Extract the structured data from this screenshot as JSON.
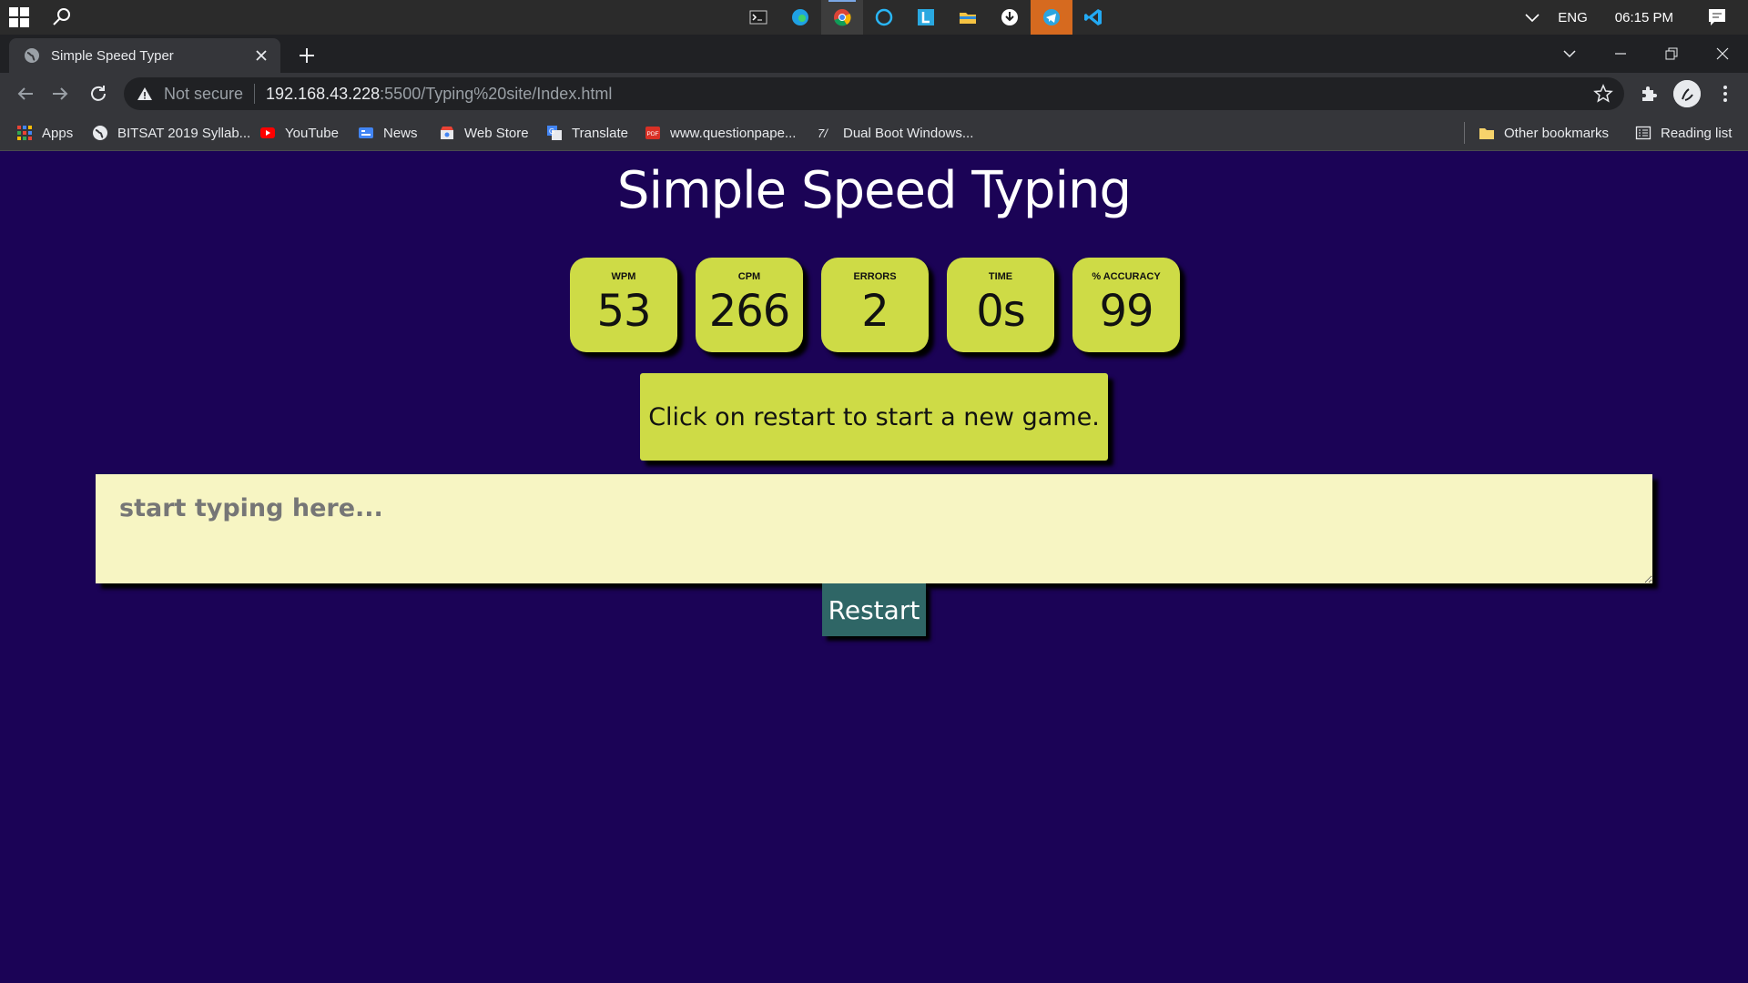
{
  "taskbar": {
    "lang": "ENG",
    "time": "06:15 PM",
    "apps": [
      "terminal-icon",
      "edge-icon",
      "chrome-icon",
      "cortana-icon",
      "l-app-icon",
      "file-explorer-icon",
      "download-icon",
      "telegram-icon",
      "vscode-icon"
    ]
  },
  "browser": {
    "tab_title": "Simple Speed Typer",
    "security_label": "Not secure",
    "url_host": "192.168.43.228",
    "url_path": ":5500/Typing%20site/Index.html"
  },
  "bookmarks": {
    "items": [
      {
        "label": "Apps",
        "icon": "apps-grid-icon"
      },
      {
        "label": "BITSAT 2019 Syllab...",
        "icon": "globe-icon"
      },
      {
        "label": "YouTube",
        "icon": "youtube-icon"
      },
      {
        "label": "News",
        "icon": "google-news-icon"
      },
      {
        "label": "Web Store",
        "icon": "web-store-icon"
      },
      {
        "label": "Translate",
        "icon": "translate-icon"
      },
      {
        "label": "www.questionpape...",
        "icon": "pdf-icon"
      },
      {
        "label": "Dual Boot Windows...",
        "icon": "dual-boot-icon"
      }
    ],
    "other": "Other bookmarks",
    "reading_list": "Reading list"
  },
  "page": {
    "title": "Simple Speed Typing",
    "stats": [
      {
        "label": "WPM",
        "value": "53"
      },
      {
        "label": "CPM",
        "value": "266"
      },
      {
        "label": "ERRORS",
        "value": "2"
      },
      {
        "label": "TIME",
        "value": "0s"
      },
      {
        "label": "% ACCURACY",
        "value": "99"
      }
    ],
    "quote": "Click on restart to start a new game.",
    "input_placeholder": "start typing here...",
    "restart_label": "Restart"
  },
  "colors": {
    "page_bg": "#1b0356",
    "card_bg": "#cedb46",
    "input_bg": "#f7f5c3",
    "restart_bg": "#2f6666"
  }
}
